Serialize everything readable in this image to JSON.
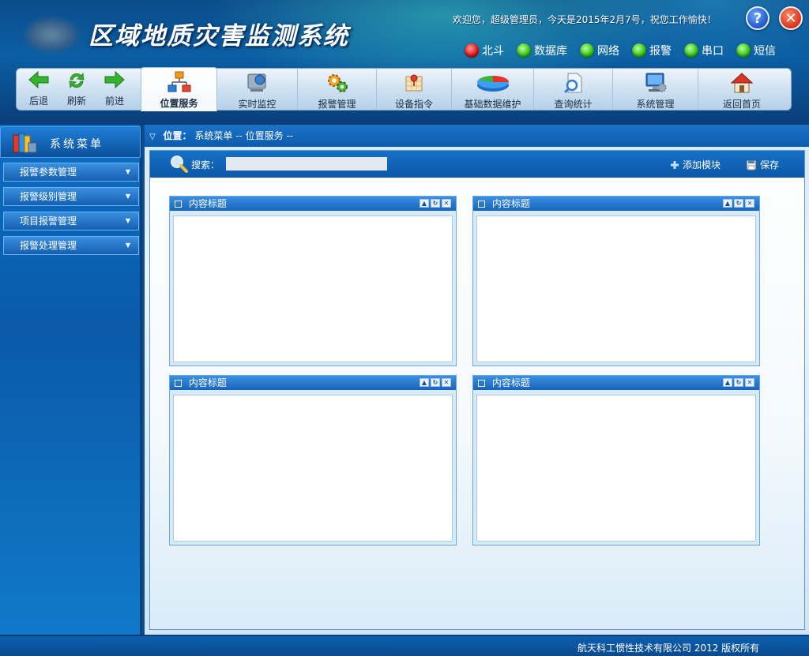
{
  "header": {
    "title": "区域地质灾害监测系统",
    "welcome": "欢迎您，超级管理员，今天是2015年2月7号，祝您工作愉快！",
    "help_glyph": "?",
    "close_glyph": "✕"
  },
  "status": [
    {
      "label": "北斗",
      "color": "red"
    },
    {
      "label": "数据库",
      "color": "green"
    },
    {
      "label": "网络",
      "color": "green"
    },
    {
      "label": "报警",
      "color": "green"
    },
    {
      "label": "串口",
      "color": "green"
    },
    {
      "label": "短信",
      "color": "green"
    }
  ],
  "nav": {
    "back": "后退",
    "refresh": "刷新",
    "forward": "前进"
  },
  "tabs": [
    {
      "label": "位置服务",
      "icon": "org-chart-icon",
      "active": true
    },
    {
      "label": "实时监控",
      "icon": "monitor-icon",
      "active": false
    },
    {
      "label": "报警管理",
      "icon": "gears-icon",
      "active": false
    },
    {
      "label": "设备指令",
      "icon": "map-pin-icon",
      "active": false
    },
    {
      "label": "基础数据维护",
      "icon": "pie-chart-icon",
      "active": false
    },
    {
      "label": "查询统计",
      "icon": "document-search-icon",
      "active": false
    },
    {
      "label": "系统管理",
      "icon": "computer-icon",
      "active": false
    },
    {
      "label": "返回首页",
      "icon": "home-icon",
      "active": false
    }
  ],
  "sidebar": {
    "title": "系统菜单",
    "items": [
      {
        "label": "报警参数管理"
      },
      {
        "label": "报警级别管理"
      },
      {
        "label": "项目报警管理"
      },
      {
        "label": "报警处理管理"
      }
    ]
  },
  "breadcrumb": {
    "prefix": "位置：",
    "path": "系统菜单 -- 位置服务 --"
  },
  "search": {
    "label": "搜索：",
    "value": "",
    "add_module": "添加模块",
    "save": "保存"
  },
  "panels": [
    {
      "title": "内容标题"
    },
    {
      "title": "内容标题"
    },
    {
      "title": "内容标题"
    },
    {
      "title": "内容标题"
    }
  ],
  "footer": {
    "copyright": "航天科工惯性技术有限公司 2012 版权所有"
  },
  "colors": {
    "brand_blue": "#0b5ea4",
    "toolbar_bg": "#cfe1f1",
    "led_red": "#e01010",
    "led_green": "#2ec014"
  }
}
